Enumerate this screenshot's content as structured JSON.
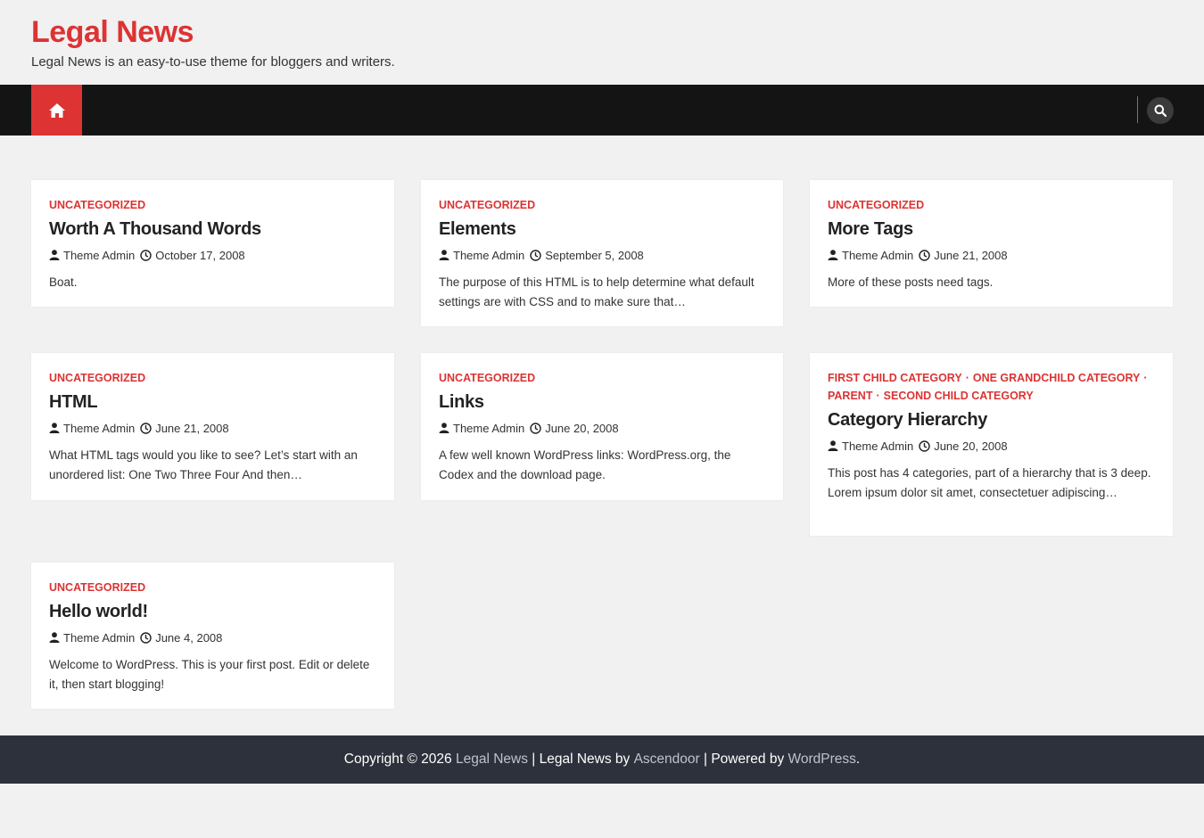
{
  "site": {
    "title": "Legal News",
    "description": "Legal News is an easy-to-use theme for bloggers and writers."
  },
  "nav": {
    "home_icon": "home-icon",
    "search_icon": "search-icon"
  },
  "posts": [
    {
      "categories": [
        "Uncategorized"
      ],
      "title": "Worth A Thousand Words",
      "author": "Theme Admin",
      "date": "October 17, 2008",
      "excerpt": "Boat."
    },
    {
      "categories": [
        "Uncategorized"
      ],
      "title": "Elements",
      "author": "Theme Admin",
      "date": "September 5, 2008",
      "excerpt": "The purpose of this HTML is to help determine what default settings are with CSS and to make sure that…"
    },
    {
      "categories": [
        "Uncategorized"
      ],
      "title": "More Tags",
      "author": "Theme Admin",
      "date": "June 21, 2008",
      "excerpt": "More of these posts need tags."
    },
    {
      "categories": [
        "Uncategorized"
      ],
      "title": "HTML",
      "author": "Theme Admin",
      "date": "June 21, 2008",
      "excerpt": "What HTML tags would you like to see? Let’s start with an unordered list: One Two Three Four And then…"
    },
    {
      "categories": [
        "Uncategorized"
      ],
      "title": "Links",
      "author": "Theme Admin",
      "date": "June 20, 2008",
      "excerpt": "A few well known WordPress links: WordPress.org, the Codex and the download page."
    },
    {
      "categories": [
        "First Child Category",
        "One Grandchild Category",
        "Parent",
        "Second Child Category"
      ],
      "title": "Category Hierarchy",
      "author": "Theme Admin",
      "date": "June 20, 2008",
      "excerpt": "This post has 4 categories, part of a hierarchy that is 3 deep. Lorem ipsum dolor sit amet, consectetuer adipiscing…"
    },
    {
      "categories": [
        "Uncategorized"
      ],
      "title": "Hello world!",
      "author": "Theme Admin",
      "date": "June 4, 2008",
      "excerpt": "Welcome to WordPress. This is your first post. Edit or delete it, then start blogging!"
    }
  ],
  "footer": {
    "prefix": "Copyright © 2026 ",
    "site_link": "Legal News",
    "mid": " | Legal News by ",
    "author_link": "Ascendoor",
    "mid2": " | Powered by ",
    "wp_link": "WordPress",
    "suffix": "."
  },
  "colors": {
    "accent": "#dd3333",
    "nav_bg": "#141414",
    "footer_bg": "#2d313b",
    "page_bg": "#f1f1f1"
  }
}
